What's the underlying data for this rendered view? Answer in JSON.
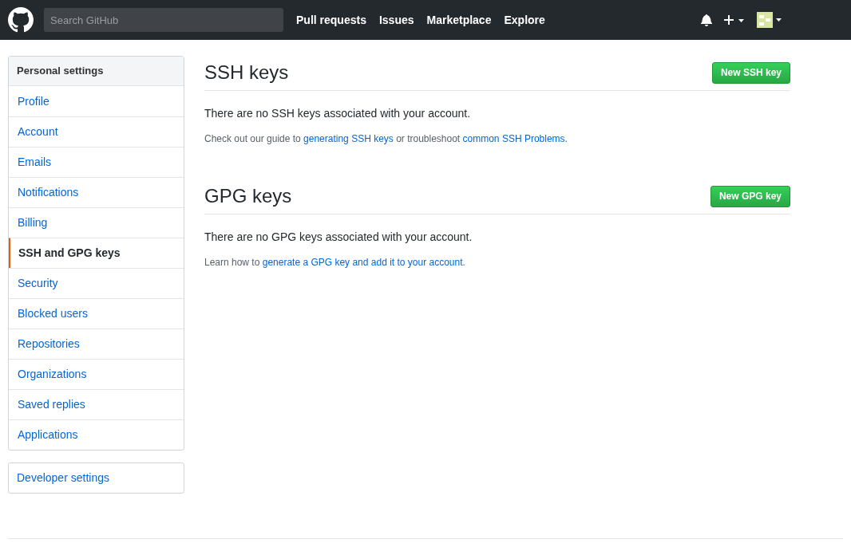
{
  "header": {
    "search": {
      "placeholder": "Search GitHub"
    },
    "nav": [
      "Pull requests",
      "Issues",
      "Marketplace",
      "Explore"
    ]
  },
  "sidebar": {
    "title": "Personal settings",
    "items": [
      {
        "label": "Profile",
        "selected": false
      },
      {
        "label": "Account",
        "selected": false
      },
      {
        "label": "Emails",
        "selected": false
      },
      {
        "label": "Notifications",
        "selected": false
      },
      {
        "label": "Billing",
        "selected": false
      },
      {
        "label": "SSH and GPG keys",
        "selected": true
      },
      {
        "label": "Security",
        "selected": false
      },
      {
        "label": "Blocked users",
        "selected": false
      },
      {
        "label": "Repositories",
        "selected": false
      },
      {
        "label": "Organizations",
        "selected": false
      },
      {
        "label": "Saved replies",
        "selected": false
      },
      {
        "label": "Applications",
        "selected": false
      }
    ],
    "developer": "Developer settings"
  },
  "sections": [
    {
      "title": "SSH keys",
      "button": "New SSH key",
      "empty": "There are no SSH keys associated with your account.",
      "note": [
        {
          "kind": "text",
          "text": "Check out our guide to "
        },
        {
          "kind": "link",
          "text": "generating SSH keys"
        },
        {
          "kind": "text",
          "text": " or troubleshoot "
        },
        {
          "kind": "link",
          "text": "common SSH Problems"
        },
        {
          "kind": "text",
          "text": "."
        }
      ]
    },
    {
      "title": "GPG keys",
      "button": "New GPG key",
      "empty": "There are no GPG keys associated with your account.",
      "note": [
        {
          "kind": "text",
          "text": "Learn how to "
        },
        {
          "kind": "link",
          "text": "generate a GPG key and add it to your account"
        },
        {
          "kind": "text",
          "text": "."
        }
      ]
    }
  ]
}
